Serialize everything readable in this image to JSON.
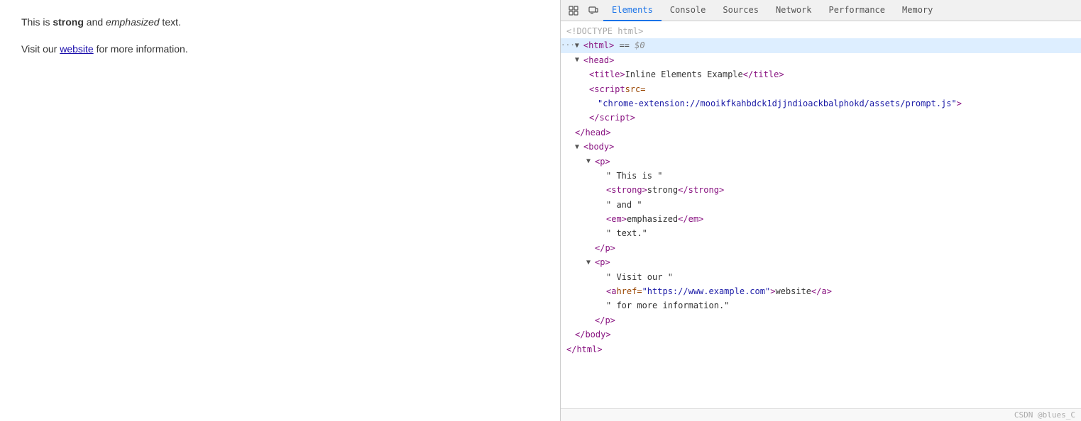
{
  "webpage": {
    "paragraph1_before": "This is ",
    "paragraph1_strong": "strong",
    "paragraph1_middle": " and ",
    "paragraph1_em": "emphasized",
    "paragraph1_after": " text.",
    "paragraph2_before": "Visit our ",
    "paragraph2_link": "website",
    "paragraph2_link_href": "https://www.example.com",
    "paragraph2_after": " for more information."
  },
  "devtools": {
    "tabs": [
      {
        "label": "Elements",
        "active": true
      },
      {
        "label": "Console",
        "active": false
      },
      {
        "label": "Sources",
        "active": false
      },
      {
        "label": "Network",
        "active": false
      },
      {
        "label": "Performance",
        "active": false
      },
      {
        "label": "Memory",
        "active": false
      }
    ],
    "footer": "CSDN @blues_C"
  }
}
